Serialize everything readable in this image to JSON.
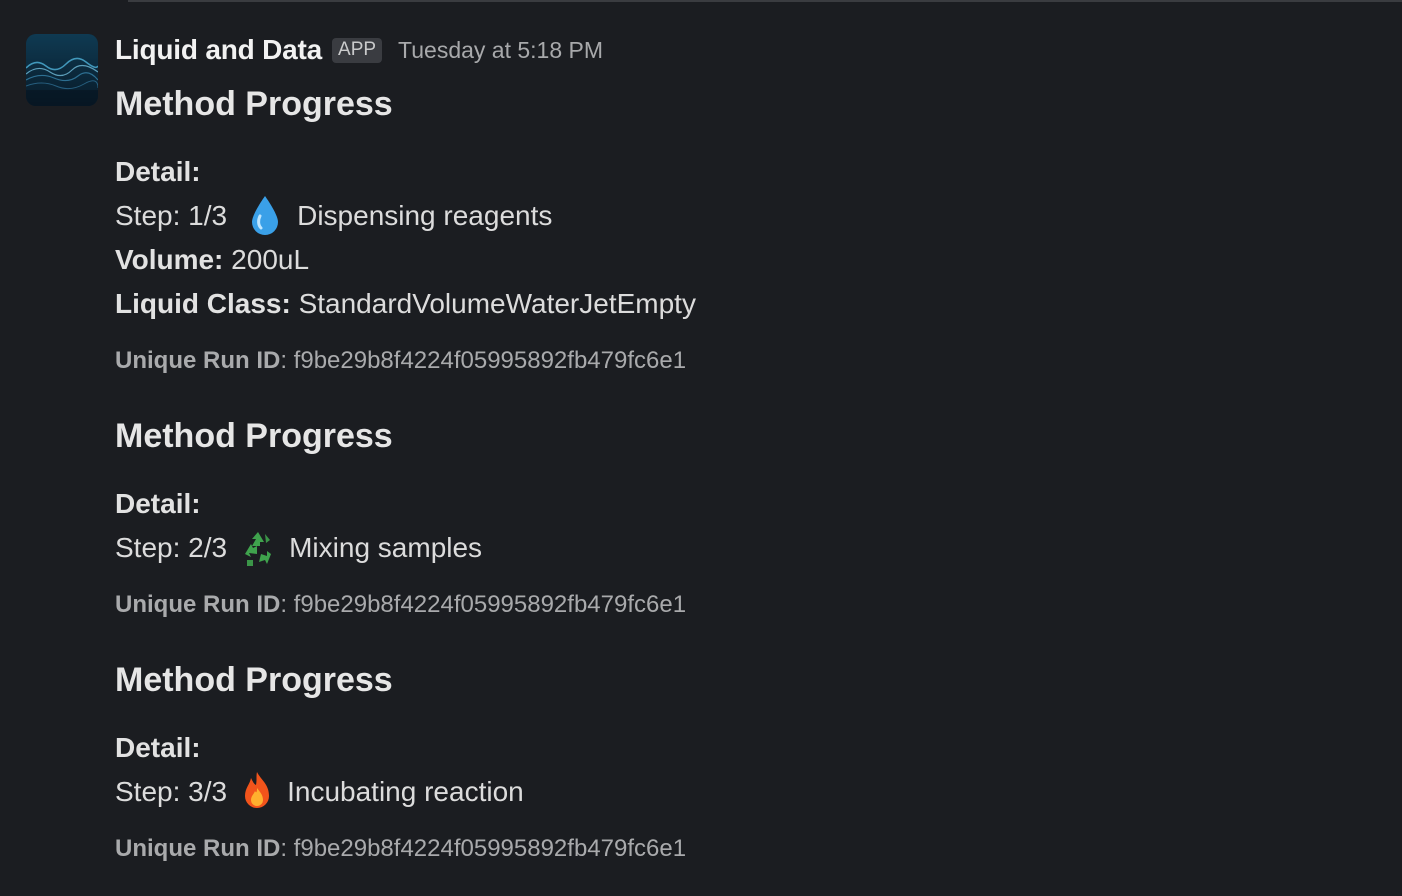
{
  "message": {
    "sender": "Liquid and Data",
    "badge": "APP",
    "timestamp": "Tuesday at 5:18 PM"
  },
  "blocks": [
    {
      "title": "Method Progress",
      "detail_label": "Detail:",
      "step_prefix": "Step:",
      "step_value": "1/3",
      "emoji": "droplet-icon",
      "step_text": "Dispensing reagents",
      "volume_label": "Volume:",
      "volume_value": "200uL",
      "liquid_class_label": "Liquid Class:",
      "liquid_class_value": "StandardVolumeWaterJetEmpty",
      "run_id_label": "Unique Run ID",
      "run_id_value": "f9be29b8f4224f05995892fb479fc6e1"
    },
    {
      "title": "Method Progress",
      "detail_label": "Detail:",
      "step_prefix": "Step:",
      "step_value": "2/3",
      "emoji": "recycle-icon",
      "step_text": "Mixing samples",
      "run_id_label": "Unique Run ID",
      "run_id_value": "f9be29b8f4224f05995892fb479fc6e1"
    },
    {
      "title": "Method Progress",
      "detail_label": "Detail:",
      "step_prefix": "Step:",
      "step_value": "3/3",
      "emoji": "fire-icon",
      "step_text": "Incubating reaction",
      "run_id_label": "Unique Run ID",
      "run_id_value": "f9be29b8f4224f05995892fb479fc6e1"
    }
  ],
  "colors": {
    "background": "#1b1d21",
    "droplet": "#3aa0e8",
    "recycle": "#3fa34d",
    "fire": "#f2541b"
  }
}
